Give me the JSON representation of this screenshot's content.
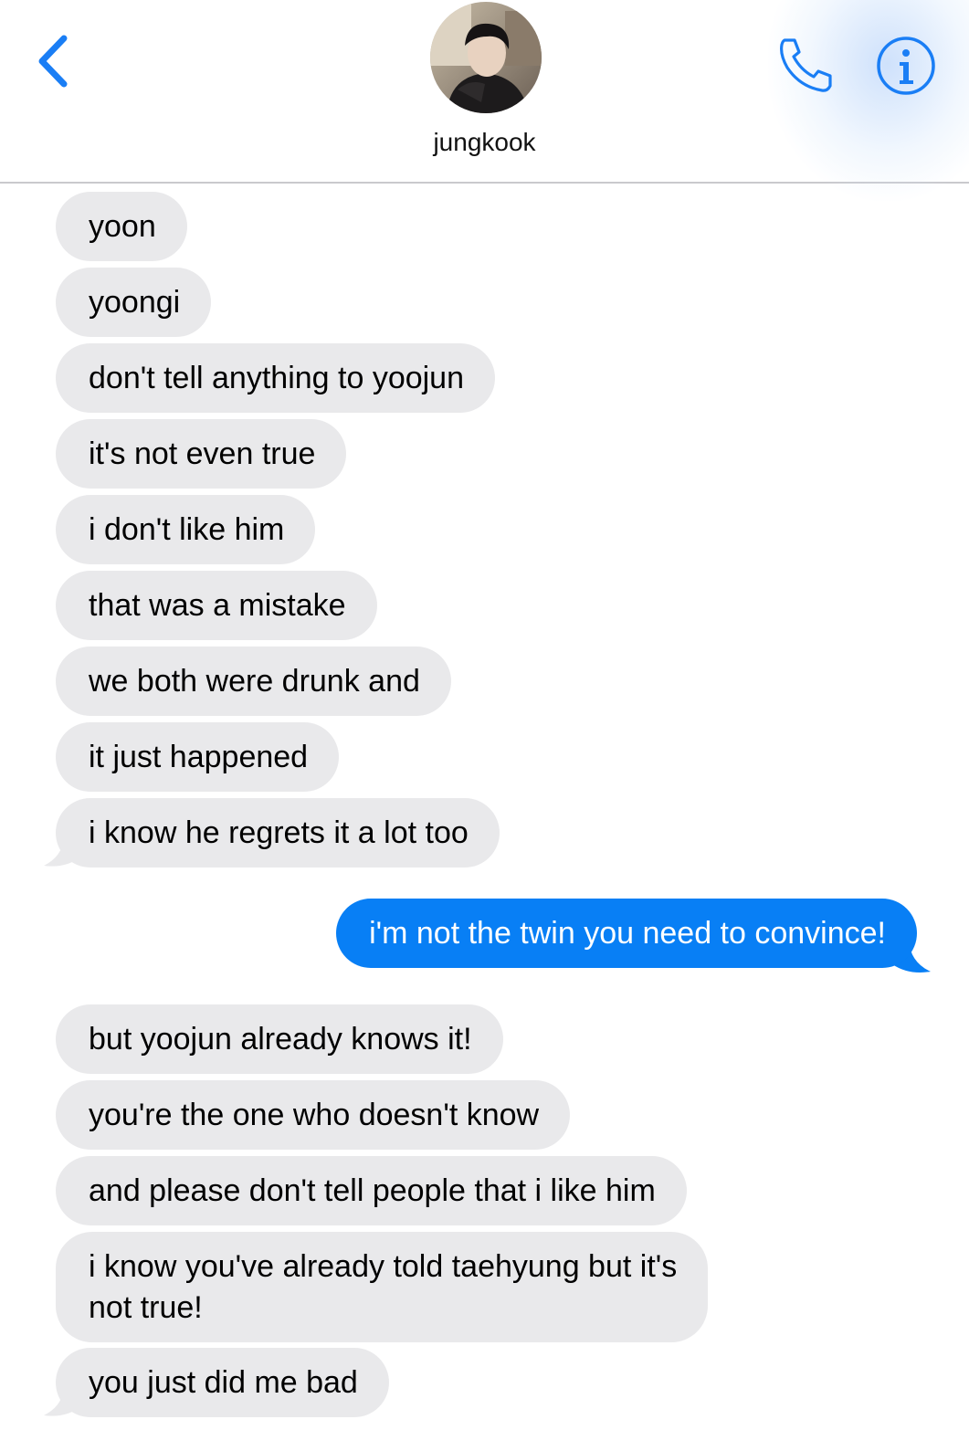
{
  "header": {
    "contact_name": "jungkook",
    "back_icon": "chevron-left-icon",
    "call_icon": "phone-icon",
    "info_icon": "info-icon",
    "accent": "#1a7ef5"
  },
  "colors": {
    "incoming_bubble": "#e9e9eb",
    "outgoing_bubble": "#087ff5"
  },
  "messages": [
    {
      "direction": "in",
      "text": "yoon"
    },
    {
      "direction": "in",
      "text": "yoongi"
    },
    {
      "direction": "in",
      "text": "don't tell anything to yoojun"
    },
    {
      "direction": "in",
      "text": "it's not even true"
    },
    {
      "direction": "in",
      "text": "i don't like him"
    },
    {
      "direction": "in",
      "text": "that was a mistake"
    },
    {
      "direction": "in",
      "text": "we both were drunk and"
    },
    {
      "direction": "in",
      "text": "it just happened"
    },
    {
      "direction": "in",
      "text": "i know he regrets it a lot too"
    },
    {
      "direction": "out",
      "text": "i'm not the twin you need to convince!"
    },
    {
      "direction": "in",
      "text": "but yoojun already knows it!"
    },
    {
      "direction": "in",
      "text": "you're the one who doesn't know"
    },
    {
      "direction": "in",
      "text": "and please don't tell people that i like him"
    },
    {
      "direction": "in",
      "line1": "i know you've already told taehyung but it's",
      "line2": "not true!"
    },
    {
      "direction": "in",
      "text": "you just did me bad"
    }
  ]
}
